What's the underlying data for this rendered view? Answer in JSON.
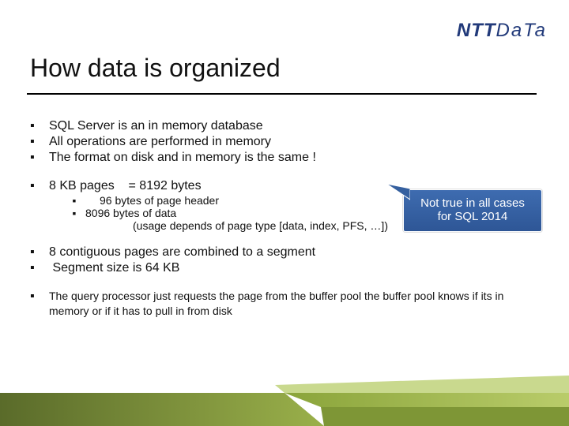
{
  "brand": {
    "bold": "NTT",
    "thin": "DaTa"
  },
  "title": "How data is organized",
  "bullets_top": [
    "SQL Server is an in memory database",
    "All operations are performed in memory",
    "The format on disk and in memory is the same !"
  ],
  "page_size": {
    "line": "8 KB pages    = 8192 bytes",
    "sub": [
      "96 bytes of page header",
      "8096 bytes of data"
    ],
    "sub_detail": "(usage depends of page type [data, index, PFS, …])"
  },
  "segment": [
    "8 contiguous pages are combined to a segment",
    " Segment size is 64 KB"
  ],
  "query_line": "The query processor just requests the page from the buffer pool the buffer pool knows if its in memory or if it has to pull in from disk",
  "callout": {
    "line1": "Not true in all cases",
    "line2": "for SQL 2014"
  }
}
